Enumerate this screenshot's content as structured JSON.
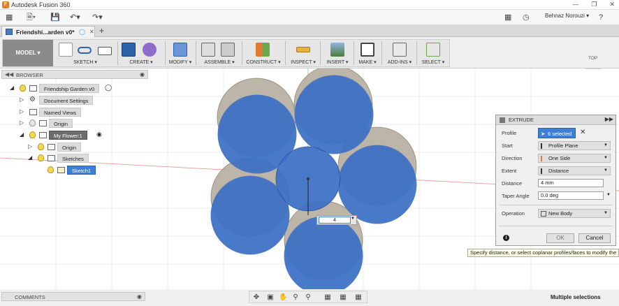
{
  "window": {
    "title": "Autodesk Fusion 360"
  },
  "qat": {
    "user": "Behnaz Norouzi ▾",
    "help": "?"
  },
  "tab": {
    "name": "Friendshi...arden v0*"
  },
  "toolbar": {
    "workspace": "MODEL ▾",
    "groups": [
      "SKETCH ▾",
      "CREATE ▾",
      "MODIFY ▾",
      "ASSEMBLE ▾",
      "CONSTRUCT ▾",
      "INSPECT ▾",
      "INSERT ▾",
      "MAKE ▾",
      "ADD-INS ▾",
      "SELECT ▾"
    ]
  },
  "browser": {
    "title": "BROWSER",
    "items": [
      {
        "label": "Friendship Garden v0"
      },
      {
        "label": "Document Settings"
      },
      {
        "label": "Named Views"
      },
      {
        "label": "Origin"
      },
      {
        "label": "My Flower:1"
      },
      {
        "label": "Origin"
      },
      {
        "label": "Sketches"
      },
      {
        "label": "Sketch1"
      }
    ]
  },
  "comments": {
    "title": "COMMENTS"
  },
  "status": {
    "text": "Multiple selections"
  },
  "viewcube": {
    "label": "TOP"
  },
  "distance_input": {
    "value": "4"
  },
  "extrude": {
    "title": "EXTRUDE",
    "profile_label": "Profile",
    "profile_value": "6 selected",
    "start_label": "Start",
    "start_value": "Profile Plane",
    "direction_label": "Direction",
    "direction_value": "One Side",
    "extent_label": "Extent",
    "extent_value": "Distance",
    "distance_label": "Distance",
    "distance_value": "4 mm",
    "taper_label": "Taper Angle",
    "taper_value": "0.0 deg",
    "operation_label": "Operation",
    "operation_value": "New Body",
    "ok": "OK",
    "cancel": "Cancel"
  },
  "tooltip": {
    "text": "Specify distance, or select coplanar profiles/faces to modify the"
  },
  "colors": {
    "accent": "#3d7fd4",
    "body_fill": "#3a6fc4",
    "shadow": "#bdb5a8"
  }
}
